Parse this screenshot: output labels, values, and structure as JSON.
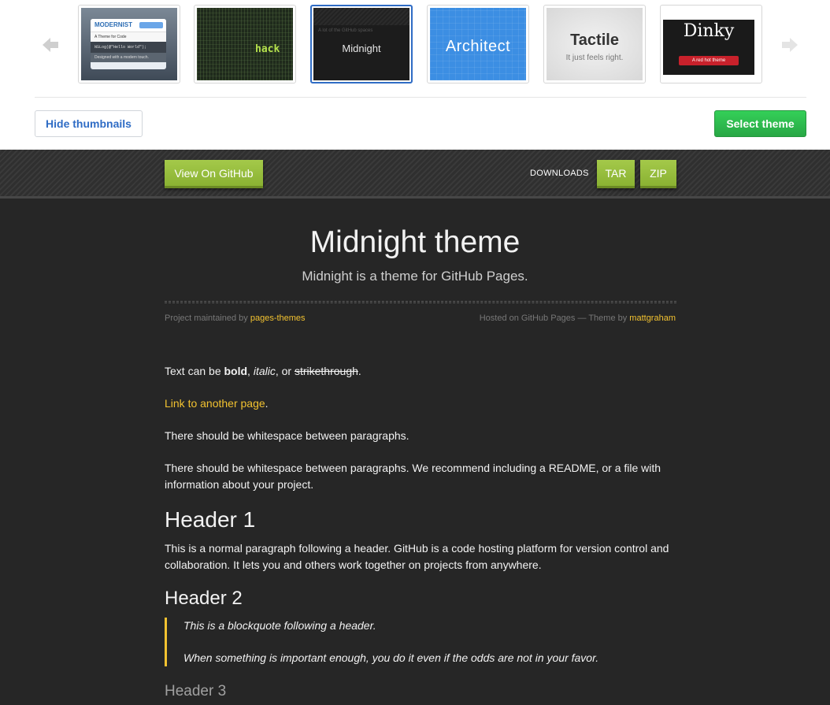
{
  "chooser": {
    "themes": [
      {
        "name": "Modernist",
        "title": "MODERNIST",
        "line1": "A Theme for Code",
        "line2": "NSLog(@\"Hello World\");",
        "line3": "Designed with a modern touch."
      },
      {
        "name": "Hack",
        "title": "hack"
      },
      {
        "name": "Midnight",
        "title": "Midnight",
        "small": "A lot of the GitHub spaces"
      },
      {
        "name": "Architect",
        "title": "Architect"
      },
      {
        "name": "Tactile",
        "title": "Tactile",
        "subtitle": "It just feels right."
      },
      {
        "name": "Dinky",
        "title": "Dinky",
        "badge": "A red hot theme"
      }
    ],
    "selected_theme": "Midnight",
    "hide_thumbnails_label": "Hide thumbnails",
    "select_theme_label": "Select theme"
  },
  "site_header": {
    "view_on_github": "View On GitHub",
    "downloads_label": "DOWNLOADS",
    "tar_label": "TAR",
    "zip_label": "ZIP"
  },
  "content": {
    "title": "Midnight theme",
    "tagline": "Midnight is a theme for GitHub Pages.",
    "maintained_prefix": "Project maintained by ",
    "maintained_link": "pages-themes",
    "hosted_prefix": "Hosted on GitHub Pages — Theme by ",
    "hosted_link": "mattgraham",
    "para1": {
      "prefix": "Text can be ",
      "bold": "bold",
      "sep1": ", ",
      "italic": "italic",
      "sep2": ", or ",
      "strike": "strikethrough",
      "suffix": "."
    },
    "link_paragraph": {
      "link": "Link to another page",
      "suffix": "."
    },
    "para2": "There should be whitespace between paragraphs.",
    "para3": "There should be whitespace between paragraphs. We recommend including a README, or a file with information about your project.",
    "header1": "Header 1",
    "para4": "This is a normal paragraph following a header. GitHub is a code hosting platform for version control and collaboration. It lets you and others work together on projects from anywhere.",
    "header2": "Header 2",
    "blockquote": [
      "This is a blockquote following a header.",
      "When something is important enough, you do it even if the odds are not in your favor."
    ],
    "header3": "Header 3"
  },
  "colors": {
    "link_yellow": "#f2c230",
    "button_green": "#8ab232",
    "select_green": "#28a745",
    "selected_border_blue": "#2f6cc5"
  }
}
